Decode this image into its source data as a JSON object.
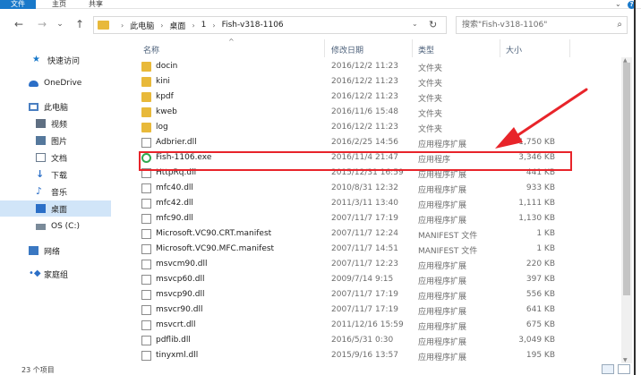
{
  "ribbon": {
    "tabs": [
      "文件",
      "主页",
      "共享"
    ],
    "file_color": "#1979ca"
  },
  "nav": {
    "back": "←",
    "forward": "→",
    "dropdown": "⌄",
    "up": "↑",
    "breadcrumbs": [
      "此电脑",
      "桌面",
      "1",
      "Fish-v318-1106"
    ],
    "refresh": "↻",
    "search_placeholder": "搜索\"Fish-v318-1106\""
  },
  "sidebar": [
    {
      "label": "快速访问",
      "icon": "star-icon"
    },
    {
      "label": "OneDrive",
      "icon": "cloud-icon"
    },
    {
      "label": "此电脑",
      "icon": "computer-icon"
    },
    {
      "label": "视频",
      "icon": "video-icon"
    },
    {
      "label": "图片",
      "icon": "picture-icon"
    },
    {
      "label": "文档",
      "icon": "document-icon"
    },
    {
      "label": "下载",
      "icon": "download-icon"
    },
    {
      "label": "音乐",
      "icon": "music-icon"
    },
    {
      "label": "桌面",
      "icon": "desktop-icon",
      "selected": true
    },
    {
      "label": "OS (C:)",
      "icon": "drive-icon"
    },
    {
      "label": "网络",
      "icon": "network-icon"
    },
    {
      "label": "家庭组",
      "icon": "homegroup-icon"
    }
  ],
  "columns": {
    "name": "名称",
    "date": "修改日期",
    "type": "类型",
    "size": "大小"
  },
  "files": [
    {
      "name": "docin",
      "date": "2016/12/2 11:23",
      "type": "文件夹",
      "size": "",
      "kind": "folder"
    },
    {
      "name": "kini",
      "date": "2016/12/2 11:23",
      "type": "文件夹",
      "size": "",
      "kind": "folder"
    },
    {
      "name": "kpdf",
      "date": "2016/12/2 11:23",
      "type": "文件夹",
      "size": "",
      "kind": "folder"
    },
    {
      "name": "kweb",
      "date": "2016/11/6 15:48",
      "type": "文件夹",
      "size": "",
      "kind": "folder"
    },
    {
      "name": "log",
      "date": "2016/12/2 11:23",
      "type": "文件夹",
      "size": "",
      "kind": "folder"
    },
    {
      "name": "Adbrier.dll",
      "date": "2016/2/25 14:56",
      "type": "应用程序扩展",
      "size": "1,750 KB",
      "kind": "dll"
    },
    {
      "name": "Fish-1106.exe",
      "date": "2016/11/4 21:47",
      "type": "应用程序",
      "size": "3,346 KB",
      "kind": "exe",
      "highlighted": true
    },
    {
      "name": "HttpRq.dll",
      "date": "2015/12/31 16:59",
      "type": "应用程序扩展",
      "size": "441 KB",
      "kind": "dll"
    },
    {
      "name": "mfc40.dll",
      "date": "2010/8/31 12:32",
      "type": "应用程序扩展",
      "size": "933 KB",
      "kind": "dll"
    },
    {
      "name": "mfc42.dll",
      "date": "2011/3/11 13:40",
      "type": "应用程序扩展",
      "size": "1,111 KB",
      "kind": "dll"
    },
    {
      "name": "mfc90.dll",
      "date": "2007/11/7 17:19",
      "type": "应用程序扩展",
      "size": "1,130 KB",
      "kind": "dll"
    },
    {
      "name": "Microsoft.VC90.CRT.manifest",
      "date": "2007/11/7 12:24",
      "type": "MANIFEST 文件",
      "size": "1 KB",
      "kind": "file"
    },
    {
      "name": "Microsoft.VC90.MFC.manifest",
      "date": "2007/11/7 14:51",
      "type": "MANIFEST 文件",
      "size": "1 KB",
      "kind": "file"
    },
    {
      "name": "msvcm90.dll",
      "date": "2007/11/7 12:23",
      "type": "应用程序扩展",
      "size": "220 KB",
      "kind": "dll"
    },
    {
      "name": "msvcp60.dll",
      "date": "2009/7/14 9:15",
      "type": "应用程序扩展",
      "size": "397 KB",
      "kind": "dll"
    },
    {
      "name": "msvcp90.dll",
      "date": "2007/11/7 17:19",
      "type": "应用程序扩展",
      "size": "556 KB",
      "kind": "dll"
    },
    {
      "name": "msvcr90.dll",
      "date": "2007/11/7 17:19",
      "type": "应用程序扩展",
      "size": "641 KB",
      "kind": "dll"
    },
    {
      "name": "msvcrt.dll",
      "date": "2011/12/16 15:59",
      "type": "应用程序扩展",
      "size": "675 KB",
      "kind": "dll"
    },
    {
      "name": "pdflib.dll",
      "date": "2016/5/31 0:30",
      "type": "应用程序扩展",
      "size": "3,049 KB",
      "kind": "dll"
    },
    {
      "name": "tinyxml.dll",
      "date": "2015/9/16 13:57",
      "type": "应用程序扩展",
      "size": "195 KB",
      "kind": "dll"
    }
  ],
  "status": {
    "count": "23 个项目"
  },
  "colors": {
    "highlight": "#e8242a",
    "selected_bg": "#d1e5f8",
    "folder": "#e8b93a"
  }
}
